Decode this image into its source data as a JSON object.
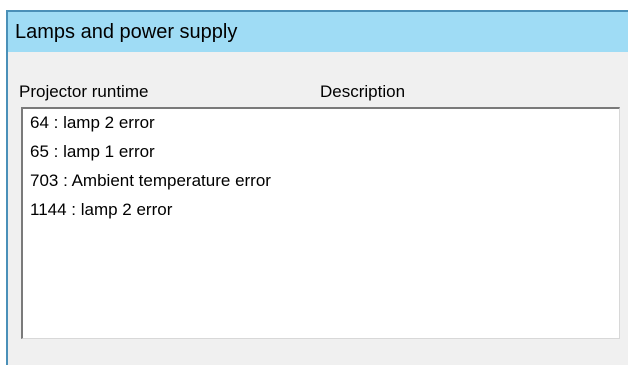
{
  "panel": {
    "title": "Lamps and power supply",
    "title_bg_color": "#9fdcf5",
    "border_color": "#4a90b8"
  },
  "columns": {
    "runtime": "Projector runtime",
    "description": "Description"
  },
  "error_list": {
    "items": [
      "64 : lamp 2 error",
      "65 : lamp 1 error",
      "703 : Ambient temperature error",
      "1144 : lamp 2 error"
    ]
  }
}
